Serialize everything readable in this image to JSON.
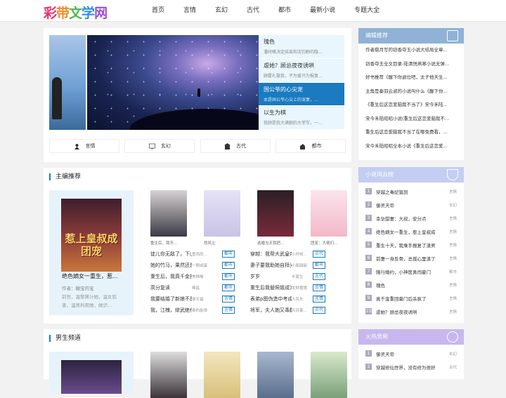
{
  "site": {
    "logo_chars": [
      "彩",
      "带",
      "文",
      "学",
      "网"
    ]
  },
  "nav": {
    "items": [
      "首页",
      "言情",
      "玄幻",
      "古代",
      "都市",
      "最新小说",
      "专题大全"
    ]
  },
  "banner": {
    "slides": [
      {
        "title": "瑰色",
        "desc": "潘时曦决定结束和沈钧野的隐..."
      },
      {
        "title": "虐她？顾总夜夜诱哄",
        "desc": "顾霍礼娶我，不为爱只为报复..."
      },
      {
        "title": "国公爷的心尖宠",
        "desc": "本是国公爷心尖上的宠妻，..."
      },
      {
        "title": "以生为棋",
        "desc": "我顾是我大满朝的大宰军，一..."
      }
    ],
    "categories": [
      {
        "label": "言情",
        "icon": "romance-icon"
      },
      {
        "label": "玄幻",
        "icon": "fantasy-icon"
      },
      {
        "label": "古代",
        "icon": "ancient-icon"
      },
      {
        "label": "都市",
        "icon": "city-icon"
      }
    ]
  },
  "editor_pick": {
    "title": "主编推荐",
    "featured": {
      "cover_text": "惹上皇叔成团宠",
      "title": "绝色嫡女一重生，惹...",
      "author": "作者：糖宝的宝",
      "desc": "前世，温黎算计她，温女陷害，温男利用她，她识..."
    },
    "books": [
      {
        "title": "重生后，我不...",
        "color": "#3a3a44"
      },
      {
        "title": "怒风尘",
        "color": "#c9c3e6"
      },
      {
        "title": "逃婚当天我把...",
        "color": "#7a2a3a"
      },
      {
        "title": "团宠：大佬们...",
        "color": "#f2b8c8"
      }
    ],
    "list": [
      {
        "title": "徒儿你无敌了，下山...",
        "meta": "重雨雨...",
        "tag": "都市"
      },
      {
        "title": "她的竹马，果然还是...",
        "meta": "一颗咸蛋",
        "tag": "都市"
      },
      {
        "title": "重生后，我真千金拒...",
        "meta": "美稀稀",
        "tag": "都市"
      },
      {
        "title": "高分复读",
        "meta": "稀昌",
        "tag": "都市"
      },
      {
        "title": "我要结婚了新娘不是我",
        "meta": "谢天福",
        "tag": "言情"
      },
      {
        "title": "我，江槐，综武绝代...",
        "meta": "泰的旋律",
        "tag": "言情"
      }
    ],
    "list2": [
      {
        "title": "穿越：我帮大武皇帝...",
        "meta": "小时候...",
        "tag": "古代"
      },
      {
        "title": "妻子要我助她自拜光...",
        "meta": "小面甜甜",
        "tag": "都市"
      },
      {
        "title": "岁岁",
        "meta": "半夏生",
        "tag": "古代"
      },
      {
        "title": "重生后我替照姐成为...",
        "meta": "发财猪猪",
        "tag": "言情"
      },
      {
        "title": "表弟p图伪造中考成绩...",
        "meta": "大风车",
        "tag": "言情"
      },
      {
        "title": "将军，夫人她又毒翻...",
        "meta": "苏苏姜...",
        "tag": "古代"
      }
    ]
  },
  "male_channel": {
    "title": "男生频道",
    "book_colors": [
      "#3c3238",
      "#d9c07a",
      "#5a6e8c",
      "#7aa07a"
    ]
  },
  "sidebar": {
    "editor_rec": {
      "title": "编辑推荐",
      "color": "#8fb2d6",
      "items": [
        "作者捌月写的窃香夺玉小说大结局全章...",
        "窃香夺玉全文目录-陆清悦燕寒小说无弹...",
        "好书推荐《醒下你退位吧，太子他天生...",
        "主角是秦羽云淑的小说叫什么《醒下你...",
        "《重生后这恋爱脑我不当了》宋今禾陆...",
        "宋今禾陆昭昭小说(重生后这恋爱脑我不...",
        "重生后这恋爱脑我不当了在哪免费看，...",
        "宋今禾陆昭昭全本小说《重生后这恋爱..."
      ]
    },
    "rank": {
      "title": "小说风云榜",
      "color": "#c3cef2",
      "items": [
        {
          "n": "1",
          "t": "穿越之毒妃猖到",
          "c": "言情"
        },
        {
          "n": "2",
          "t": "御灵天帝",
          "c": "玄幻"
        },
        {
          "n": "3",
          "t": "幸孕甜妻：大叔，安分点",
          "c": "言情"
        },
        {
          "n": "4",
          "t": "绝色嫡女一重生，惹上皇叔成",
          "c": "言情"
        },
        {
          "n": "5",
          "t": "重生十天，我乘手报复了渣男",
          "c": "言情"
        },
        {
          "n": "6",
          "t": "前妻一身反骨，总裁心里渣了",
          "c": "言情"
        },
        {
          "n": "7",
          "t": "隆行婚约，小神医勇闯豪门",
          "c": "都市"
        },
        {
          "n": "8",
          "t": "瑰色",
          "c": "言情"
        },
        {
          "n": "9",
          "t": "真千金重回豪门后杀疯了",
          "c": "言情"
        },
        {
          "n": "10",
          "t": "虐她？顾总夜夜诱哄",
          "c": "言情"
        }
      ]
    },
    "hot_male": {
      "title": "火热男频",
      "color": "#c6b8ee",
      "items": [
        {
          "n": "1",
          "t": "御灵天帝",
          "c": "玄幻"
        },
        {
          "n": "2",
          "t": "穿越修仙世界，没有修为很好",
          "c": "古代"
        }
      ]
    }
  }
}
